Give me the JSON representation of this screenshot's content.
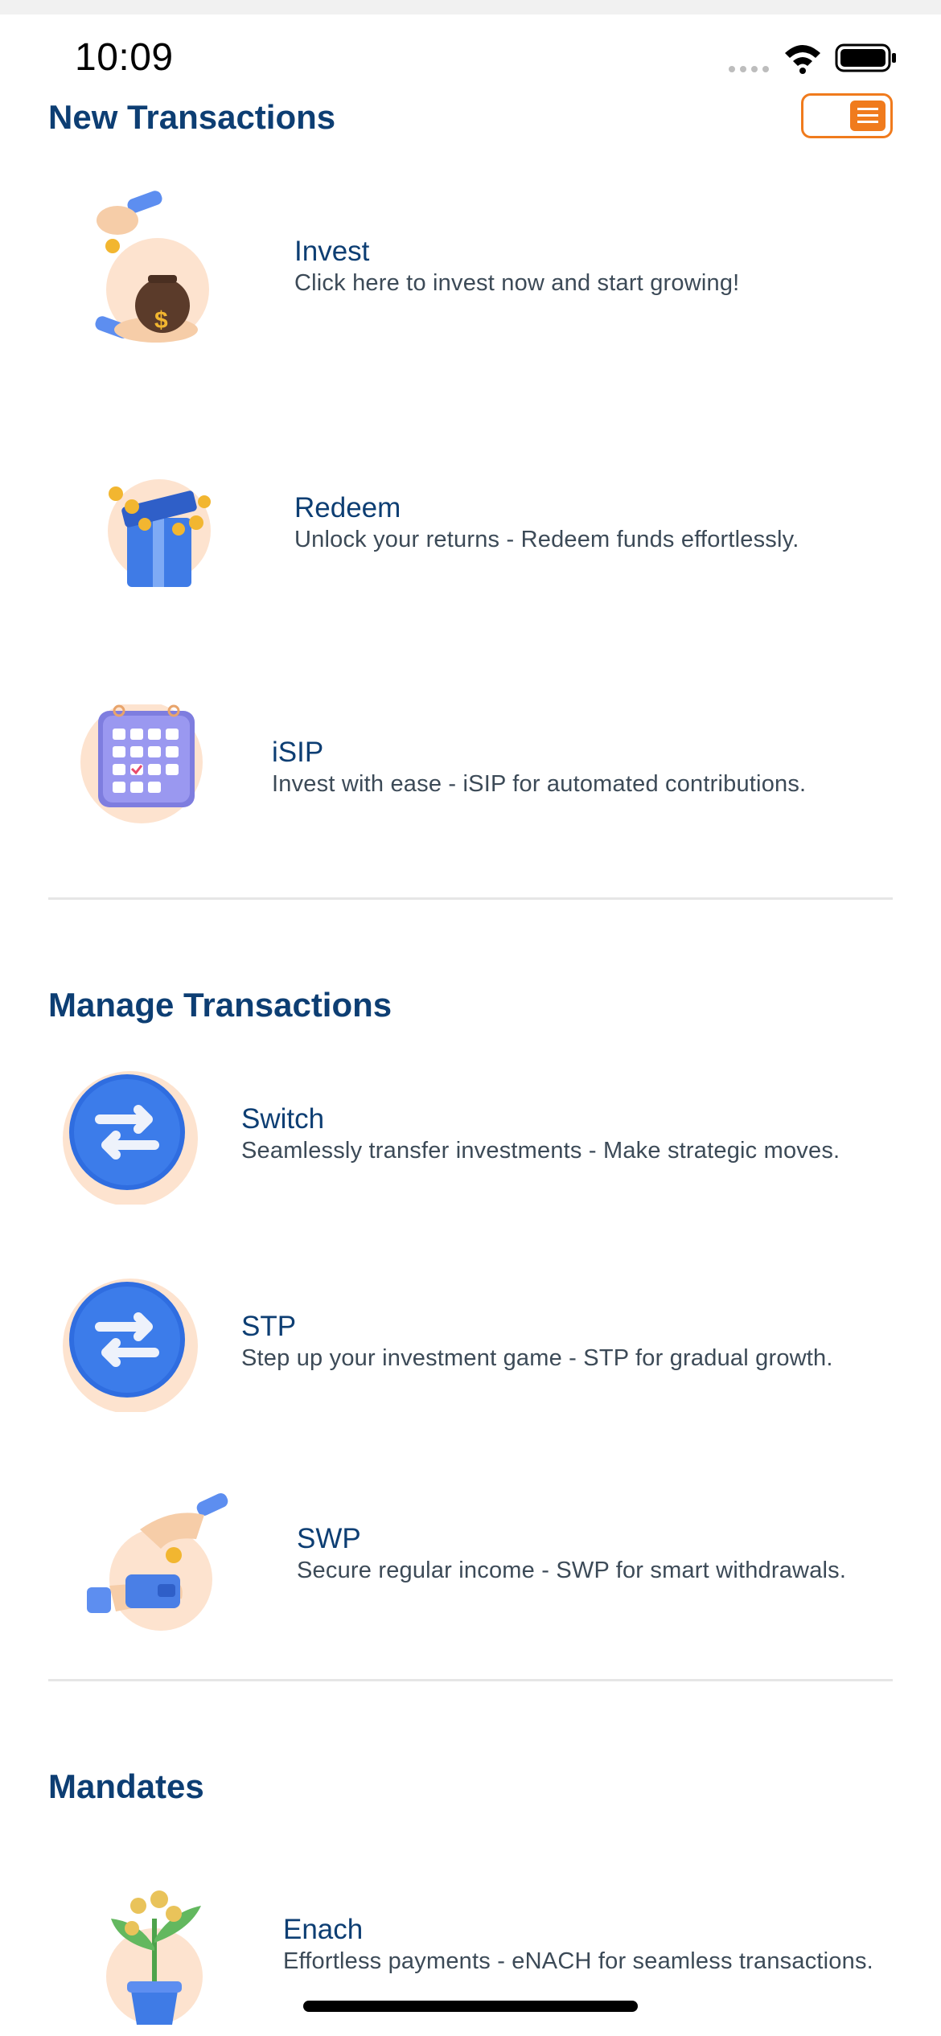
{
  "status_bar": {
    "time": "10:09"
  },
  "sections": {
    "new": {
      "title": "New Transactions",
      "items": [
        {
          "title": "Invest",
          "description": "Click here to invest now and start growing!",
          "icon": "money-bag-icon"
        },
        {
          "title": "Redeem",
          "description": "Unlock your returns - Redeem funds effortlessly.",
          "icon": "gift-box-icon"
        },
        {
          "title": "iSIP",
          "description": "Invest with ease - iSIP for automated contributions.",
          "icon": "calendar-icon"
        }
      ]
    },
    "manage": {
      "title": "Manage Transactions",
      "items": [
        {
          "title": "Switch",
          "description": "Seamlessly transfer investments - Make strategic moves.",
          "icon": "swap-arrows-icon"
        },
        {
          "title": "STP",
          "description": "Step up your investment game - STP for gradual growth.",
          "icon": "swap-arrows-icon"
        },
        {
          "title": "SWP",
          "description": "Secure regular income - SWP for smart withdrawals.",
          "icon": "wallet-hand-icon"
        }
      ]
    },
    "mandates": {
      "title": "Mandates",
      "items": [
        {
          "title": "Enach",
          "description": "Effortless payments - eNACH for seamless transactions.",
          "icon": "money-plant-icon"
        }
      ]
    }
  },
  "colors": {
    "heading": "#0d3e73",
    "accent": "#f07b1d",
    "icon_blue": "#2f6de0",
    "peach": "#fbd2b3"
  }
}
